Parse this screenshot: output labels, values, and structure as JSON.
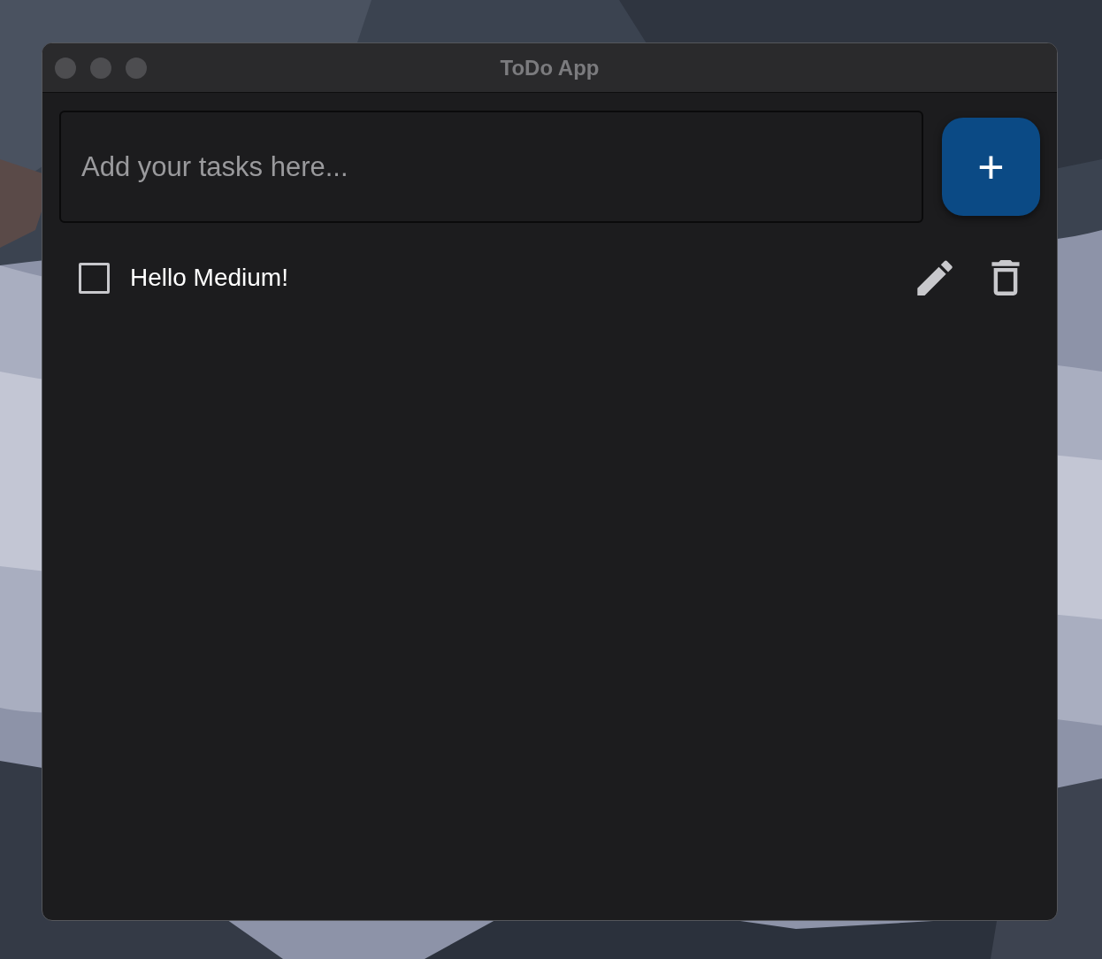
{
  "window": {
    "title": "ToDo App"
  },
  "new_task": {
    "placeholder": "Add your tasks here..."
  },
  "add_button": {
    "label": "+"
  },
  "tasks": [
    {
      "text": "Hello Medium!",
      "checked": false
    }
  ]
}
